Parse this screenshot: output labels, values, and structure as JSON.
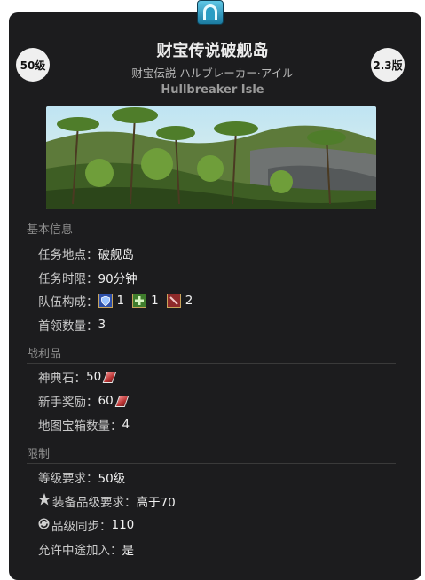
{
  "level_badge": "50级",
  "version_badge": "2.3版",
  "title": "财宝传说破舰岛",
  "subtitle_jp": "财宝伝説 ハルブレーカー·アイル",
  "subtitle_en": "Hullbreaker Isle",
  "sections": {
    "basic": {
      "heading": "基本信息",
      "location_label": "任务地点：",
      "location_value": "破舰岛",
      "time_label": "任务时限：",
      "time_value": "90分钟",
      "party_label": "队伍构成：",
      "party": {
        "tank": "1",
        "healer": "1",
        "dps": "2"
      },
      "boss_label": "首领数量：",
      "boss_value": "3"
    },
    "loot": {
      "heading": "战利品",
      "tomestone_label": "神典石：",
      "tomestone_value": "50",
      "rookie_label": "新手奖励：",
      "rookie_value": "60",
      "chest_label": "地图宝箱数量：",
      "chest_value": "4"
    },
    "limits": {
      "heading": "限制",
      "level_label": "等级要求：",
      "level_value": "50级",
      "ilvl_label": "装备品级要求：",
      "ilvl_value": "高于70",
      "sync_label": "品级同步：",
      "sync_value": "110",
      "join_label": "允许中途加入：",
      "join_value": "是"
    }
  },
  "icons": {
    "duty": "dungeon-portal-icon",
    "tank": "shield-icon",
    "healer": "healer-cross-icon",
    "dps": "sword-icon",
    "tomestone": "tomestone-icon",
    "ilvl": "star-icon",
    "sync": "sync-icon"
  }
}
